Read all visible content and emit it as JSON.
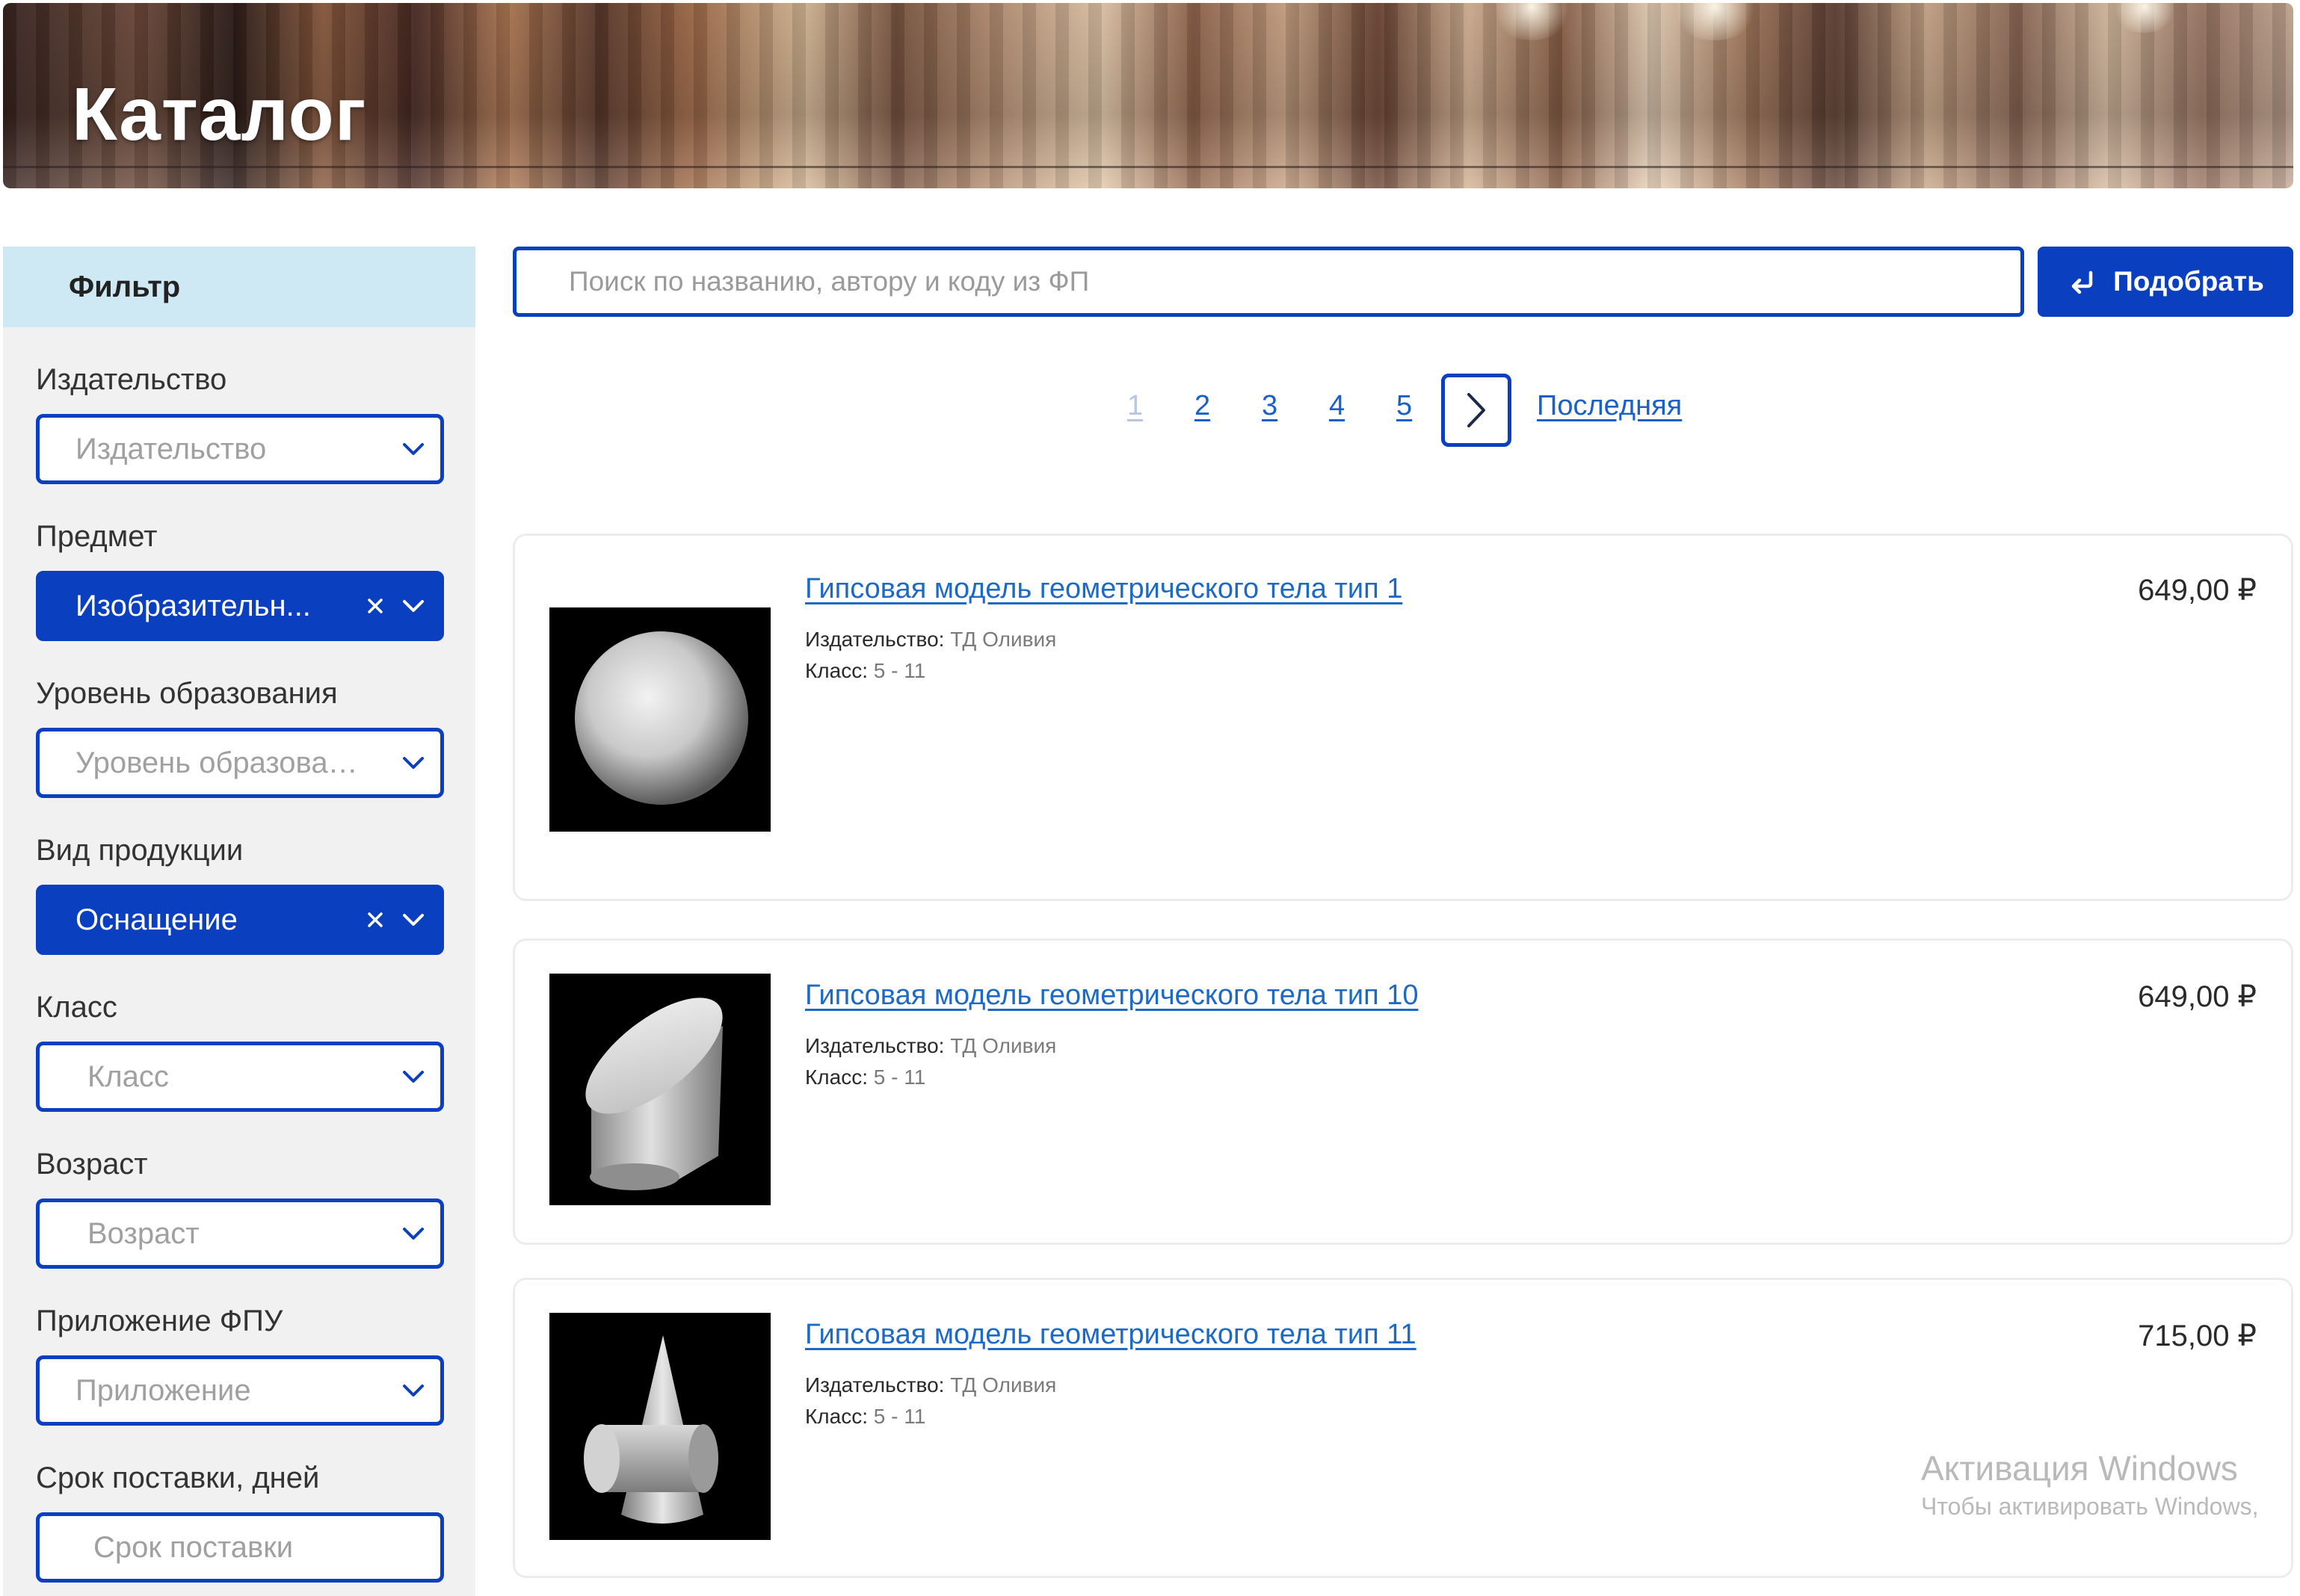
{
  "banner": {
    "title": "Каталог"
  },
  "sidebar": {
    "header": "Фильтр",
    "filters": [
      {
        "label": "Издательство",
        "value": "Издательство",
        "active": false
      },
      {
        "label": "Предмет",
        "value": "Изобразительн...",
        "active": true
      },
      {
        "label": "Уровень образования",
        "value": "Уровень образовани",
        "active": false
      },
      {
        "label": "Вид продукции",
        "value": "Оснащение",
        "active": true
      },
      {
        "label": "Класс",
        "value": "Класс",
        "active": false
      },
      {
        "label": "Возраст",
        "value": "Возраст",
        "active": false
      },
      {
        "label": "Приложение ФПУ",
        "value": "Приложение",
        "active": false
      },
      {
        "label": "Срок поставки, дней",
        "value": "Срок поставки",
        "active": false
      }
    ]
  },
  "search": {
    "placeholder": "Поиск по названию, автору и коду из ФП",
    "button_label": "Подобрать"
  },
  "pagination": {
    "pages": [
      "1",
      "2",
      "3",
      "4",
      "5"
    ],
    "current": "1",
    "last_label": "Последняя"
  },
  "products": [
    {
      "title": "Гипсовая модель геометрического тела тип 1",
      "publisher_label": "Издательство:",
      "publisher": "ТД Оливия",
      "grade_label": "Класс:",
      "grade": "5 - 11",
      "price": "649,00 ₽",
      "image": "sphere"
    },
    {
      "title": "Гипсовая модель геометрического тела тип 10",
      "publisher_label": "Издательство:",
      "publisher": "ТД Оливия",
      "grade_label": "Класс:",
      "grade": "5 - 11",
      "price": "649,00 ₽",
      "image": "truncated-cylinder"
    },
    {
      "title": "Гипсовая модель геометрического тела тип 11",
      "publisher_label": "Издательство:",
      "publisher": "ТД Оливия",
      "grade_label": "Класс:",
      "grade": "5 - 11",
      "price": "715,00 ₽",
      "image": "cone-cylinder"
    }
  ],
  "watermark": {
    "line1": "Активация Windows",
    "line2": "Чтобы активировать Windows,"
  },
  "colors": {
    "accent": "#0a3fbf",
    "filter_header_bg": "#cfe9f4",
    "link": "#1b6ac8"
  }
}
